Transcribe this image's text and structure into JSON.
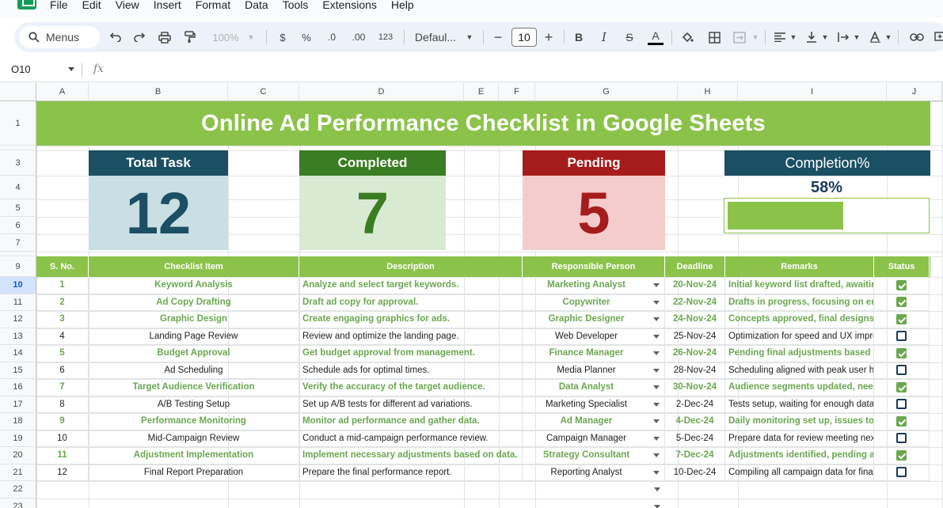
{
  "menu": [
    "File",
    "Edit",
    "View",
    "Insert",
    "Format",
    "Data",
    "Tools",
    "Extensions",
    "Help"
  ],
  "toolbar": {
    "search_label": "Menus",
    "zoom": "100%",
    "currency": "$",
    "percent": "%",
    "decrease_decimal": ".0",
    "increase_decimal": ".00",
    "number_format": "123",
    "font_family": "Defaul...",
    "font_size": "10",
    "bold": "B",
    "italic": "I",
    "strike": "S",
    "text_color": "A"
  },
  "formula_bar": {
    "cell_ref": "O10",
    "fx": "fx"
  },
  "columns": [
    "A",
    "B",
    "C",
    "D",
    "E",
    "F",
    "G",
    "H",
    "I",
    "J"
  ],
  "rows": [
    "1",
    "2",
    "3",
    "4",
    "5",
    "6",
    "7",
    "8",
    "9",
    "10",
    "11",
    "12",
    "13",
    "14",
    "15",
    "16",
    "17",
    "18",
    "19",
    "20",
    "21",
    "22",
    "23"
  ],
  "title": "Online Ad Performance Checklist in Google Sheets",
  "cards": {
    "total": {
      "label": "Total Task",
      "value": "12",
      "head_color": "#1b4f63",
      "body_color": "#c9dfe4",
      "text_color": "#1b4f63"
    },
    "completed": {
      "label": "Completed",
      "value": "7",
      "head_color": "#3a7d22",
      "body_color": "#d9ead3",
      "text_color": "#3a7d22"
    },
    "pending": {
      "label": "Pending",
      "value": "5",
      "head_color": "#a61c1c",
      "body_color": "#f4cccc",
      "text_color": "#a61c1c"
    },
    "completion": {
      "label": "Completion%",
      "value": "58%",
      "progress": 0.58,
      "head_color": "#1b4f63"
    }
  },
  "table": {
    "headers": [
      "S. No.",
      "Checklist Item",
      "Description",
      "Responsible Person",
      "Deadline",
      "Remarks",
      "Status"
    ],
    "rows": [
      {
        "no": "1",
        "item": "Keyword Analysis",
        "desc": "Analyze and select target keywords.",
        "person": "Marketing Analyst",
        "deadline": "20-Nov-24",
        "remarks": "Initial keyword list drafted, awaiting",
        "done": true
      },
      {
        "no": "2",
        "item": "Ad Copy Drafting",
        "desc": "Draft ad copy for approval.",
        "person": "Copywriter",
        "deadline": "22-Nov-24",
        "remarks": "Drafts in progress, focusing on emo",
        "done": true
      },
      {
        "no": "3",
        "item": "Graphic Design",
        "desc": "Create engaging graphics for ads.",
        "person": "Graphic Designer",
        "deadline": "24-Nov-24",
        "remarks": "Concepts approved, final designs by",
        "done": true
      },
      {
        "no": "4",
        "item": "Landing Page Review",
        "desc": "Review and optimize the landing page.",
        "person": "Web Developer",
        "deadline": "25-Nov-24",
        "remarks": "Optimization for speed and UX improve",
        "done": false
      },
      {
        "no": "5",
        "item": "Budget Approval",
        "desc": "Get budget approval from management.",
        "person": "Finance Manager",
        "deadline": "26-Nov-24",
        "remarks": "Pending final adjustments based on",
        "done": true
      },
      {
        "no": "6",
        "item": "Ad Scheduling",
        "desc": "Schedule ads for optimal times.",
        "person": "Media Planner",
        "deadline": "28-Nov-24",
        "remarks": "Scheduling aligned with peak user hou",
        "done": false
      },
      {
        "no": "7",
        "item": "Target Audience Verification",
        "desc": "Verify the accuracy of the target audience.",
        "person": "Data Analyst",
        "deadline": "30-Nov-24",
        "remarks": "Audience segments updated, need r",
        "done": true
      },
      {
        "no": "8",
        "item": "A/B Testing Setup",
        "desc": "Set up A/B tests for different ad variations.",
        "person": "Marketing Specialist",
        "deadline": "2-Dec-24",
        "remarks": "Tests setup, waiting for enough data to",
        "done": false
      },
      {
        "no": "9",
        "item": "Performance Monitoring",
        "desc": "Monitor ad performance and gather data.",
        "person": "Ad Manager",
        "deadline": "4-Dec-24",
        "remarks": "Daily monitoring set up, issues to be",
        "done": true
      },
      {
        "no": "10",
        "item": "Mid-Campaign Review",
        "desc": "Conduct a mid-campaign performance review.",
        "person": "Campaign Manager",
        "deadline": "5-Dec-24",
        "remarks": "Prepare data for review meeting next w",
        "done": false
      },
      {
        "no": "11",
        "item": "Adjustment Implementation",
        "desc": "Implement necessary adjustments based on data.",
        "person": "Strategy Consultant",
        "deadline": "7-Dec-24",
        "remarks": "Adjustments identified, pending app",
        "done": true
      },
      {
        "no": "12",
        "item": "Final Report Preparation",
        "desc": "Prepare the final performance report.",
        "person": "Reporting Analyst",
        "deadline": "10-Dec-24",
        "remarks": "Compiling all campaign data for final a",
        "done": false
      }
    ]
  }
}
